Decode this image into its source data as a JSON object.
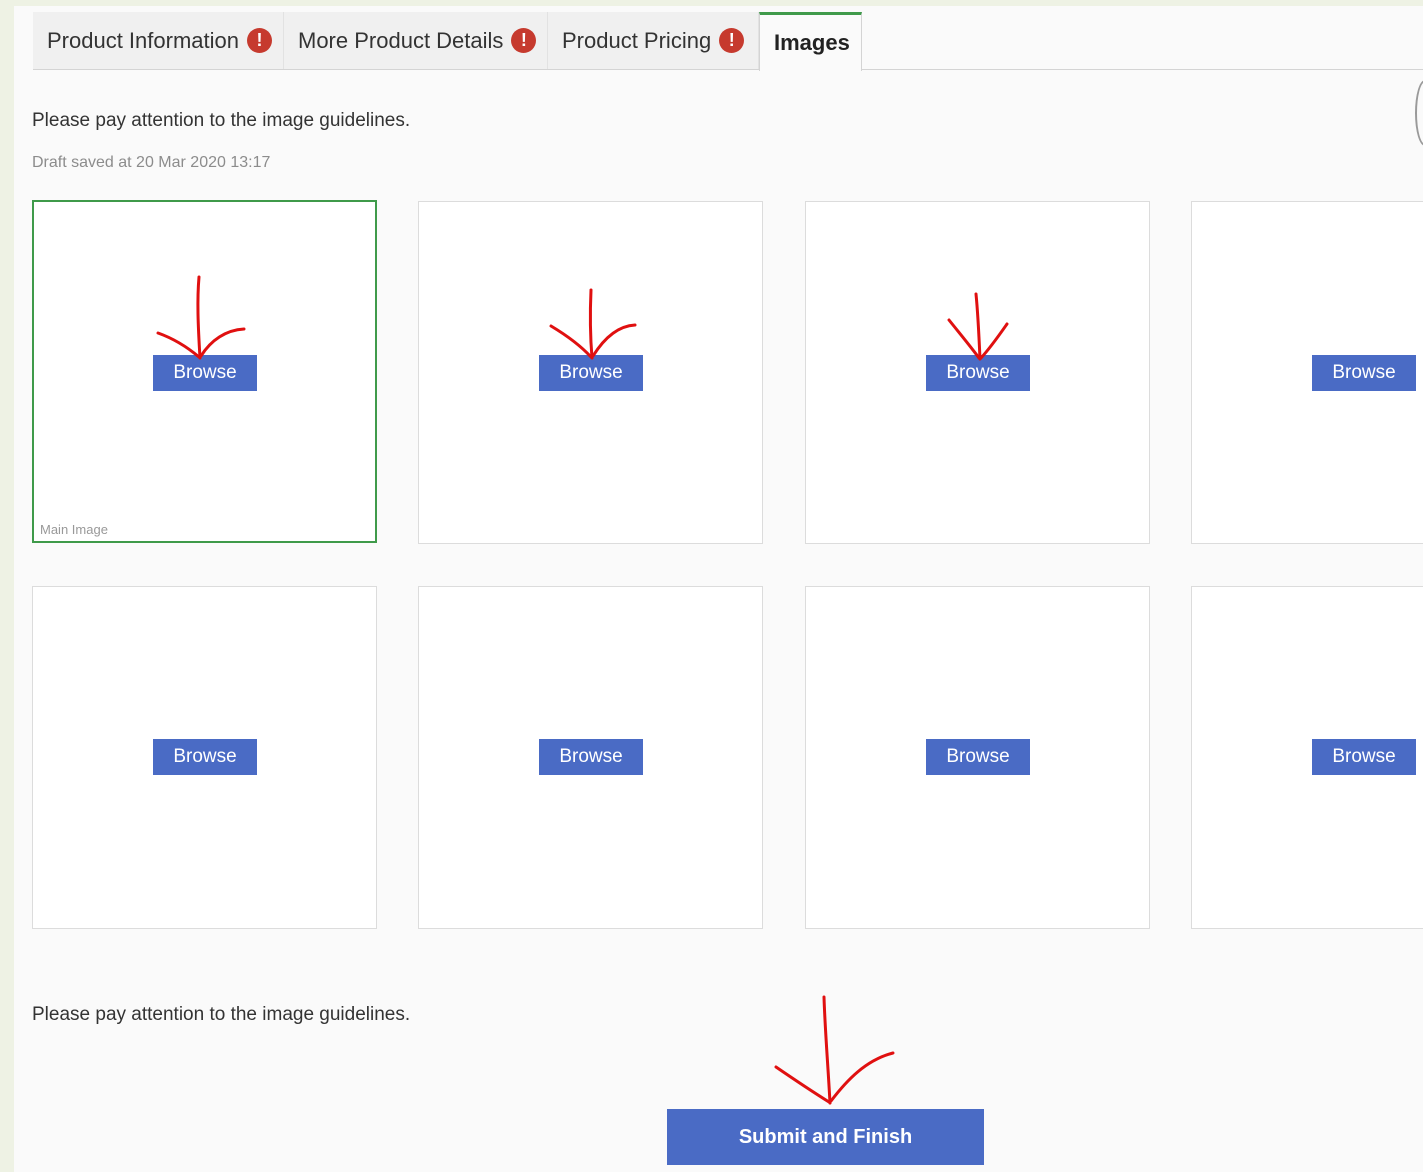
{
  "tabs": [
    {
      "label": "Product Information",
      "warning": true
    },
    {
      "label": "More Product Details",
      "warning": true
    },
    {
      "label": "Product Pricing",
      "warning": true
    },
    {
      "label": "Images",
      "warning": false,
      "active": true
    }
  ],
  "warning_glyph": "!",
  "guideline_text": "Please pay attention to the image guidelines.",
  "draft_status": "Draft saved at 20 Mar 2020 13:17",
  "image_slots": [
    {
      "browse_label": "Browse",
      "caption": "Main Image"
    },
    {
      "browse_label": "Browse"
    },
    {
      "browse_label": "Browse"
    },
    {
      "browse_label": "Browse"
    },
    {
      "browse_label": "Browse"
    },
    {
      "browse_label": "Browse"
    },
    {
      "browse_label": "Browse"
    },
    {
      "browse_label": "Browse"
    }
  ],
  "submit_label": "Submit and Finish",
  "colors": {
    "accent_blue": "#4a6bc5",
    "active_tab_green": "#3f9a4a",
    "warning_red": "#c63a2e",
    "annotation_red": "#e01010"
  }
}
